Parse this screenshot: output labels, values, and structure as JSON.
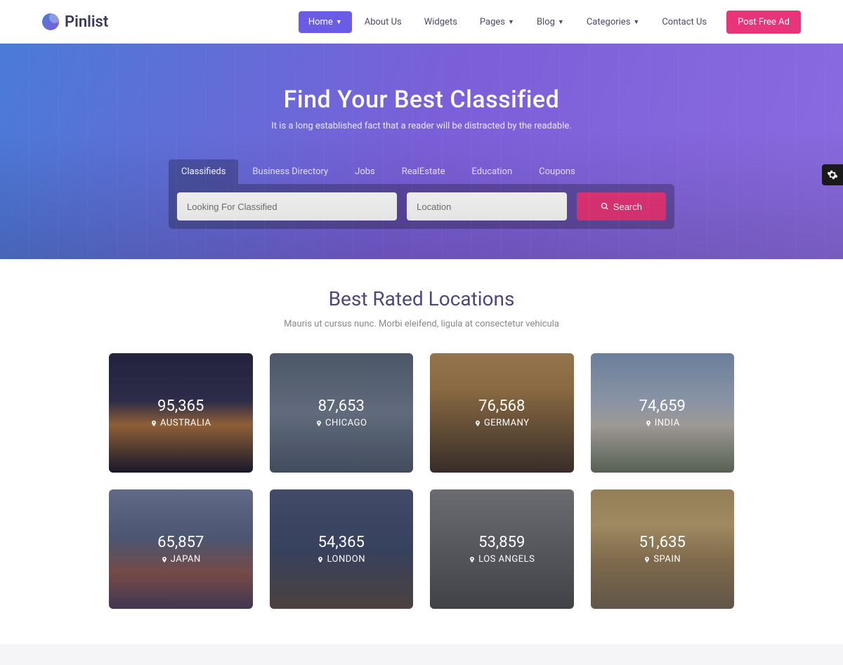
{
  "brand": "Pinlist",
  "nav": {
    "items": [
      {
        "label": "Home",
        "active": true,
        "dropdown": true
      },
      {
        "label": "About Us",
        "active": false,
        "dropdown": false
      },
      {
        "label": "Widgets",
        "active": false,
        "dropdown": false
      },
      {
        "label": "Pages",
        "active": false,
        "dropdown": true
      },
      {
        "label": "Blog",
        "active": false,
        "dropdown": true
      },
      {
        "label": "Categories",
        "active": false,
        "dropdown": true
      },
      {
        "label": "Contact Us",
        "active": false,
        "dropdown": false
      }
    ],
    "cta": "Post Free Ad"
  },
  "hero": {
    "title": "Find Your Best Classified",
    "subtitle": "It is a long established fact that a reader will be distracted by the readable."
  },
  "search": {
    "tabs": [
      "Classifieds",
      "Business Directory",
      "Jobs",
      "RealEstate",
      "Education",
      "Coupons"
    ],
    "active_tab": 0,
    "placeholder_main": "Looking For Classified",
    "placeholder_location": "Location",
    "button": "Search"
  },
  "locations": {
    "title": "Best Rated Locations",
    "subtitle": "Mauris ut cursus nunc. Morbi eleifend, ligula at consectetur vehicula",
    "cards": [
      {
        "count": "95,365",
        "name": "AUSTRALIA",
        "bg": "bg-australia"
      },
      {
        "count": "87,653",
        "name": "CHICAGO",
        "bg": "bg-chicago"
      },
      {
        "count": "76,568",
        "name": "GERMANY",
        "bg": "bg-germany"
      },
      {
        "count": "74,659",
        "name": "INDIA",
        "bg": "bg-india"
      },
      {
        "count": "65,857",
        "name": "JAPAN",
        "bg": "bg-japan"
      },
      {
        "count": "54,365",
        "name": "LONDON",
        "bg": "bg-london"
      },
      {
        "count": "53,859",
        "name": "LOS ANGELS",
        "bg": "bg-losangels"
      },
      {
        "count": "51,635",
        "name": "SPAIN",
        "bg": "bg-spain"
      }
    ]
  }
}
